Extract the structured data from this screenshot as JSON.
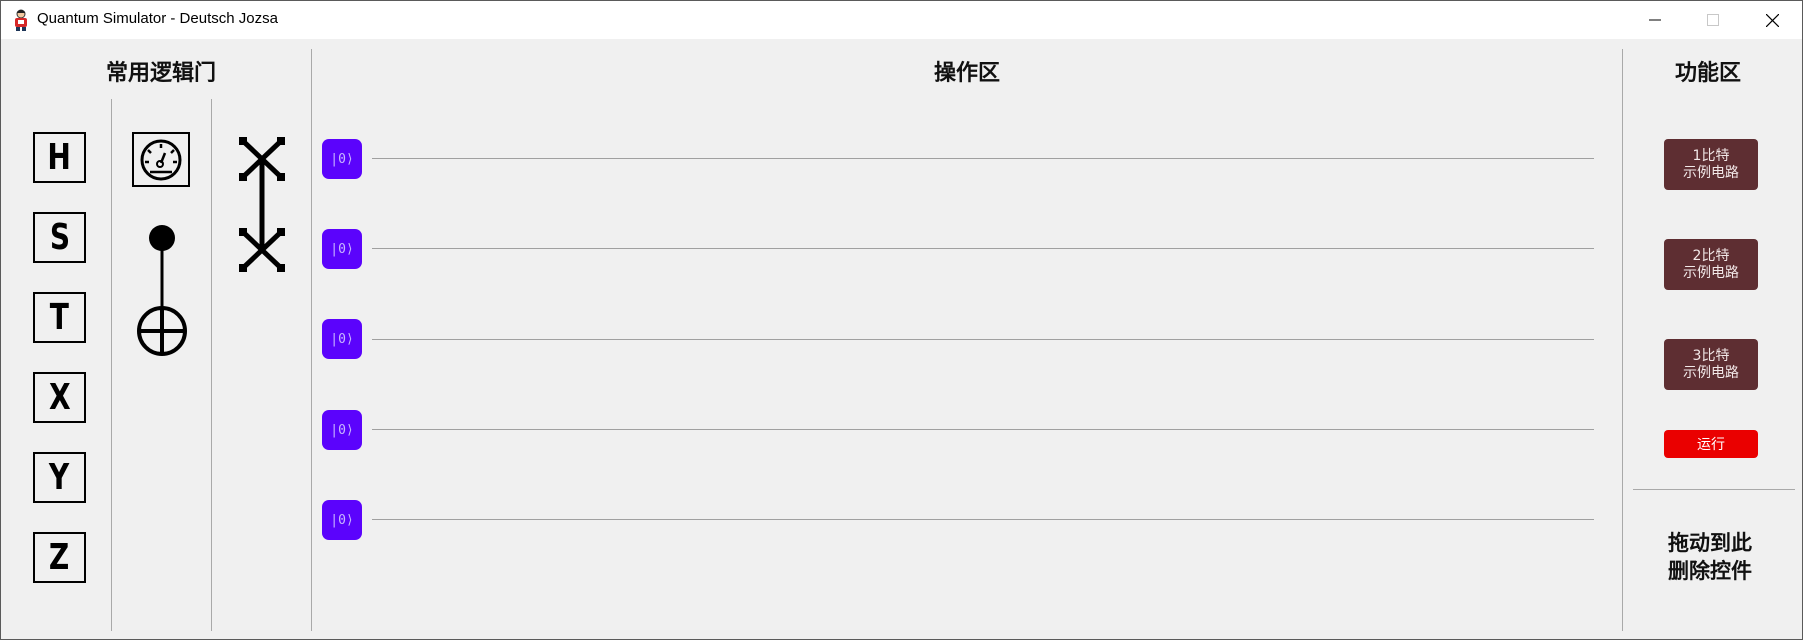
{
  "window": {
    "title": "Quantum Simulator - Deutsch Jozsa",
    "app_icon": "quantum-app-icon",
    "controls": [
      "minimize-icon",
      "maximize-icon",
      "close-icon"
    ]
  },
  "gates_panel": {
    "heading": "常用逻辑门",
    "single_qubit_gates": [
      {
        "label": "H"
      },
      {
        "label": "S"
      },
      {
        "label": "T"
      },
      {
        "label": "X"
      },
      {
        "label": "Y"
      },
      {
        "label": "Z"
      }
    ],
    "special_gates": [
      "measure-gate-icon",
      "cnot-gate-icon",
      "swap-gate-icon"
    ]
  },
  "workspace": {
    "heading": "操作区",
    "qubits": [
      {
        "state": "|0⟩"
      },
      {
        "state": "|0⟩"
      },
      {
        "state": "|0⟩"
      },
      {
        "state": "|0⟩"
      },
      {
        "state": "|0⟩"
      }
    ]
  },
  "functions_panel": {
    "heading": "功能区",
    "examples": [
      {
        "line1": "1比特",
        "line2": "示例电路"
      },
      {
        "line1": "2比特",
        "line2": "示例电路"
      },
      {
        "line1": "3比特",
        "line2": "示例电路"
      }
    ],
    "run_label": "运行",
    "trash_line1": "拖动到此",
    "trash_line2": "删除控件"
  },
  "colors": {
    "qubit_button": "#5b03fc",
    "example_button": "#5e2e32",
    "run_button": "#ea0000",
    "background": "#f0f0f0"
  }
}
